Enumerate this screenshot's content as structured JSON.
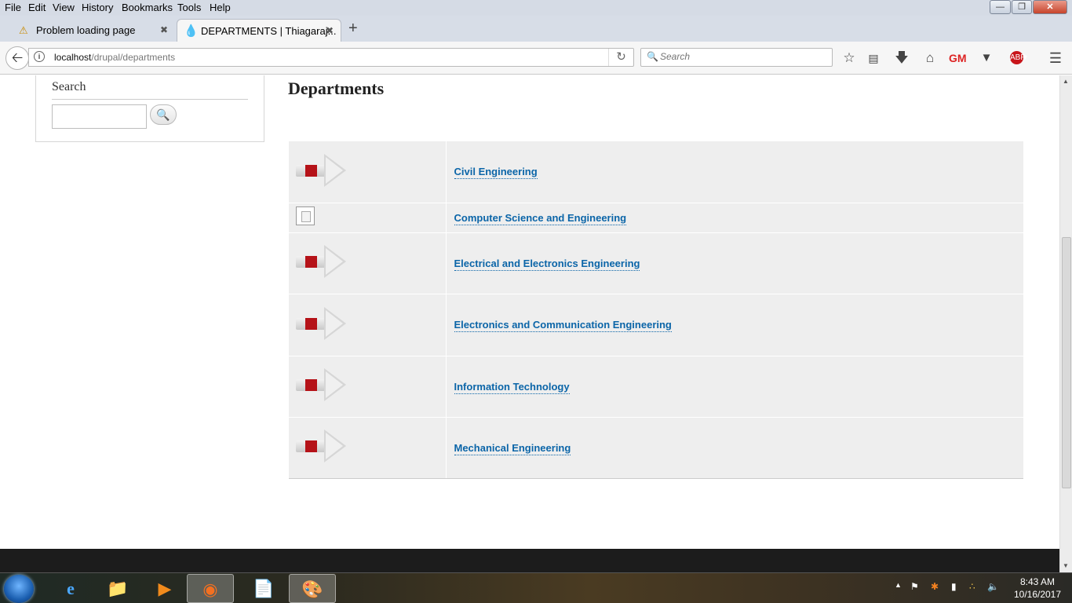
{
  "menubar": {
    "items": [
      "File",
      "Edit",
      "View",
      "History",
      "Bookmarks",
      "Tools",
      "Help"
    ]
  },
  "tabs": [
    {
      "title": "Problem loading page",
      "icon": "warning-icon"
    },
    {
      "title": "DEPARTMENTS | Thiagaraj...",
      "icon": "drupal-icon"
    }
  ],
  "navbar": {
    "url_host": "localhost",
    "url_path": "/drupal/departments",
    "search_placeholder": "Search"
  },
  "sidebar": {
    "title": "Search",
    "input_value": "",
    "submit_icon": "search-icon"
  },
  "main": {
    "title": "Departments",
    "rows": [
      {
        "name": "Civil Engineering",
        "image": "arrow-image"
      },
      {
        "name": "Computer Science and Engineering",
        "image": "broken-image"
      },
      {
        "name": "Electrical and Electronics Engineering",
        "image": "arrow-image"
      },
      {
        "name": "Electronics and Communication Engineering",
        "image": "arrow-image"
      },
      {
        "name": "Information Technology",
        "image": "arrow-image"
      },
      {
        "name": "Mechanical Engineering",
        "image": "arrow-image"
      }
    ]
  },
  "taskbar": {
    "time": "8:43 AM",
    "date": "10/16/2017"
  },
  "colors": {
    "link": "#0b65a8",
    "row_bg": "#eeeeee",
    "arrow_red": "#b51218"
  }
}
